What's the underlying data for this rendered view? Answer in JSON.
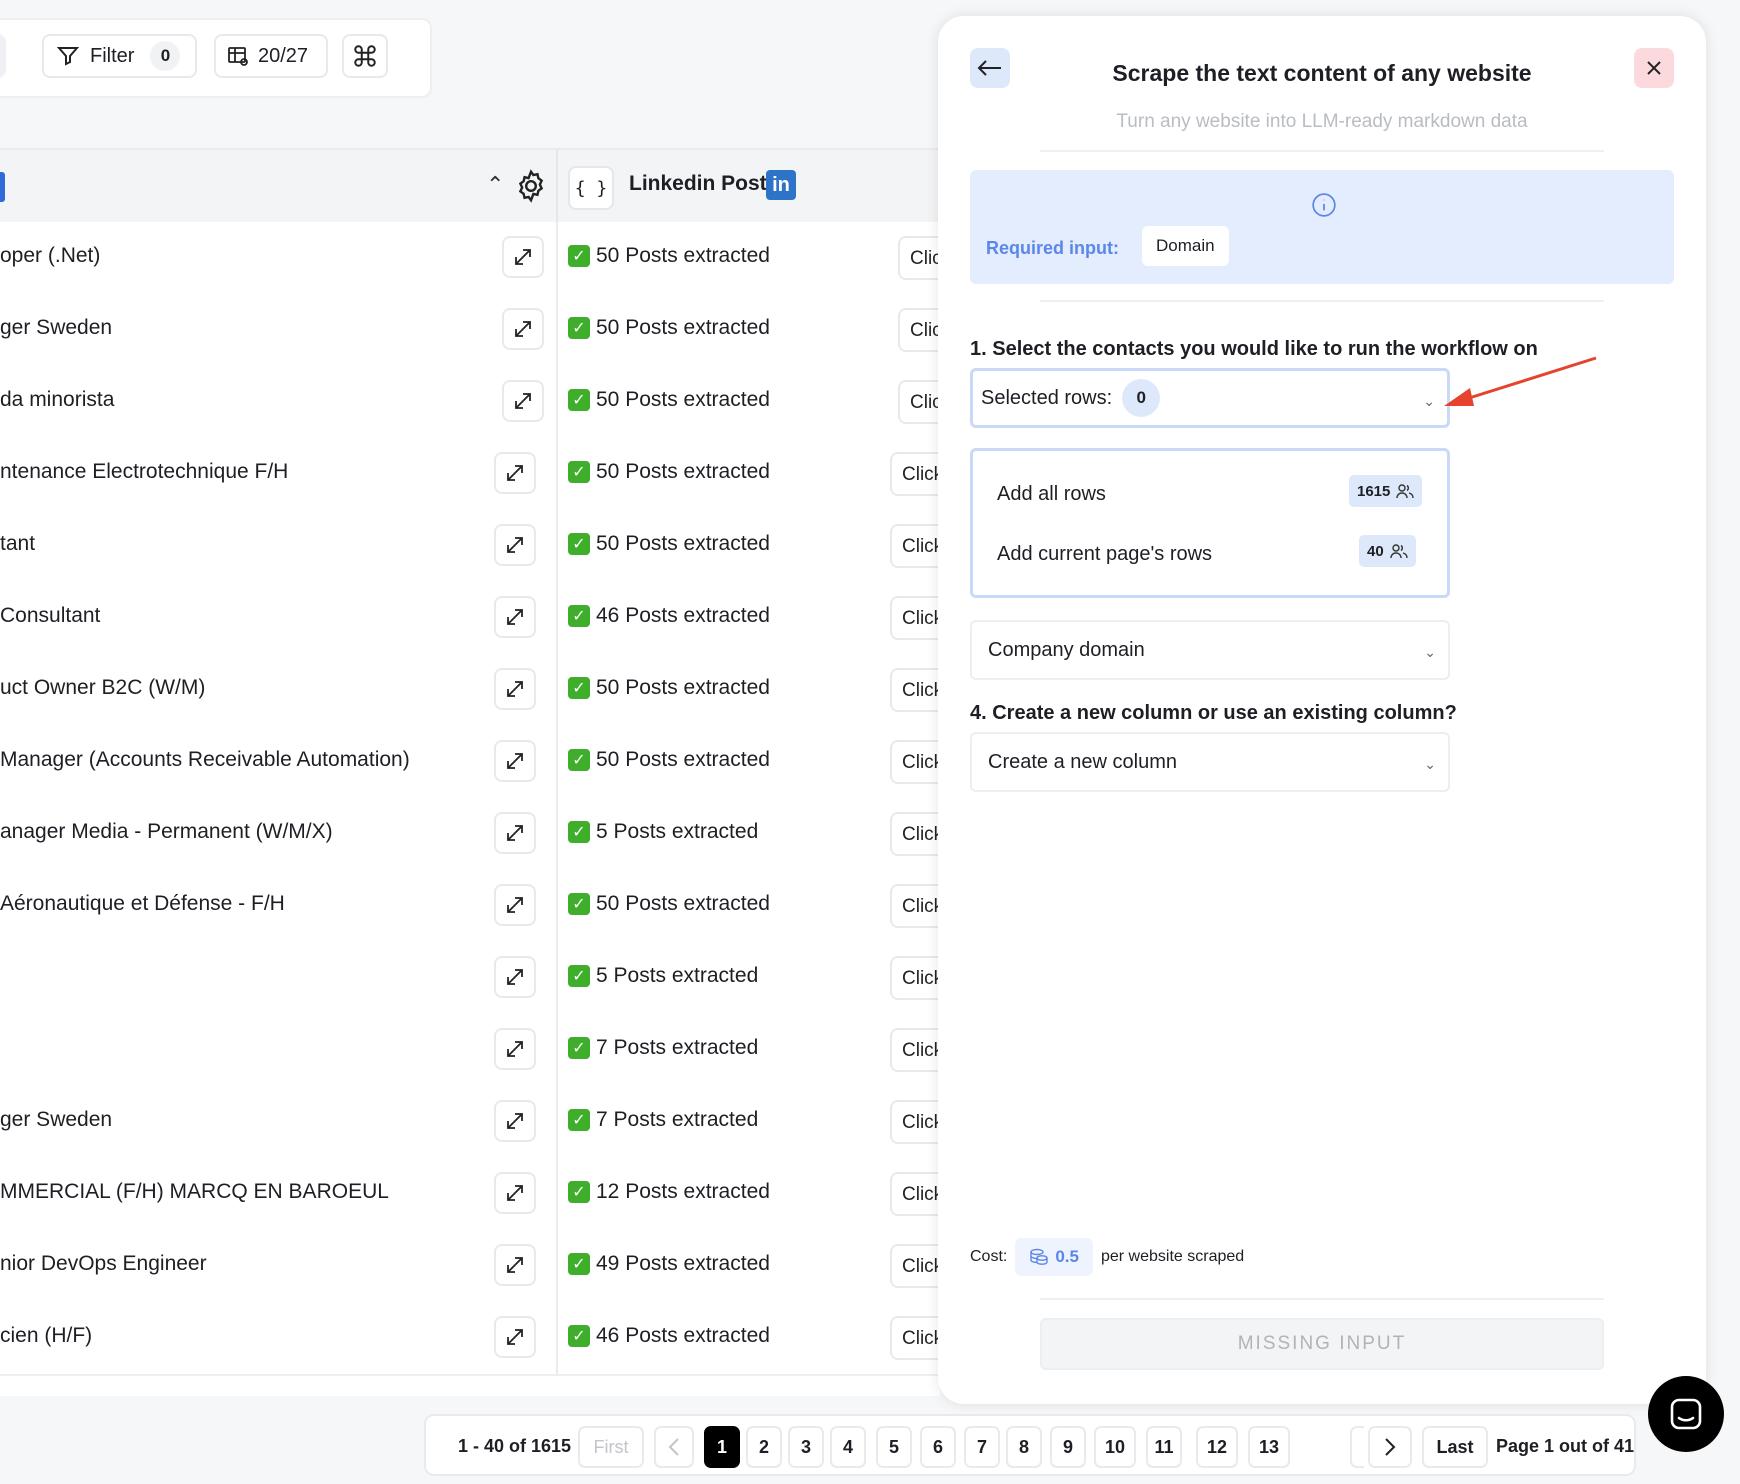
{
  "toolbar": {
    "filter_label": "Filter",
    "filter_count": "0",
    "columns_count": "20/27"
  },
  "table": {
    "linkedin_header": "Linkedin Post",
    "linkedin_badge": "in",
    "click_label": "Click",
    "rows": [
      {
        "title": "oper (.Net)",
        "posts": "50 Posts extracted"
      },
      {
        "title": "ger Sweden",
        "posts": "50 Posts extracted"
      },
      {
        "title": "da minorista",
        "posts": "50 Posts extracted"
      },
      {
        "title": "ntenance Electrotechnique F/H",
        "posts": "50 Posts extracted"
      },
      {
        "title": "tant",
        "posts": "50 Posts extracted"
      },
      {
        "title": "Consultant",
        "posts": "46 Posts extracted"
      },
      {
        "title": "uct Owner B2C (W/M)",
        "posts": "50 Posts extracted"
      },
      {
        "title": "Manager (Accounts Receivable Automation)",
        "posts": "50 Posts extracted"
      },
      {
        "title": "anager Media - Permanent (W/M/X)",
        "posts": "5 Posts extracted"
      },
      {
        "title": "Aéronautique et Défense - F/H",
        "posts": "50 Posts extracted"
      },
      {
        "title": "",
        "posts": "5 Posts extracted"
      },
      {
        "title": "",
        "posts": "7 Posts extracted"
      },
      {
        "title": "ger Sweden",
        "posts": "7 Posts extracted"
      },
      {
        "title": "MMERCIAL (F/H) MARCQ EN BAROEUL",
        "posts": "12 Posts extracted"
      },
      {
        "title": "nior DevOps Engineer",
        "posts": "49 Posts extracted"
      },
      {
        "title": "cien (H/F)",
        "posts": "46 Posts extracted"
      }
    ]
  },
  "pagination": {
    "range": "1 - 40 of 1615",
    "first": "First",
    "pages": [
      "1",
      "2",
      "3",
      "4",
      "5",
      "6",
      "7",
      "8",
      "9",
      "10",
      "11",
      "12",
      "13"
    ],
    "last": "Last",
    "page_info": "Page 1 out of 41"
  },
  "panel": {
    "title": "Scrape the text content of any website",
    "subtitle": "Turn any website into LLM-ready markdown data",
    "required_label": "Required input:",
    "required_value": "Domain",
    "step1_label": "1. Select the contacts you would like to run the workflow on",
    "selected_rows_label": "Selected rows:",
    "selected_rows_count": "0",
    "dropdown": {
      "add_all": "Add all rows",
      "add_all_count": "1615",
      "add_page": "Add current page's rows",
      "add_page_count": "40"
    },
    "company_domain": "Company domain",
    "step4_label": "4. Create a new column or use an existing column?",
    "column_choice": "Create a new column",
    "cost_label": "Cost:",
    "cost_value": "0.5",
    "cost_suffix": "per website scraped",
    "submit_label": "MISSING INPUT"
  },
  "colors": {
    "accent": "#5b87e8",
    "close_bg": "#fcd9dc",
    "arrow": "#e5432d",
    "check": "#3fae2a",
    "linkedin": "#2d73c8"
  }
}
